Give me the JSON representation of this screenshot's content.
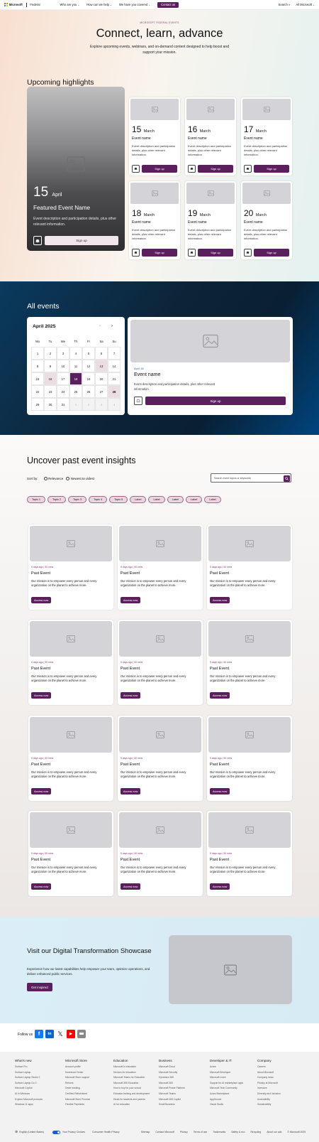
{
  "nav": {
    "brand": "Microsoft",
    "site": "Federal",
    "links": [
      "Who are you",
      "How can we help",
      "We have you covered"
    ],
    "contact": "Contact us",
    "search": "Search",
    "all": "All Microsoft",
    "logo_colors": [
      "#f25022",
      "#7fba00",
      "#00a4ef",
      "#ffb900"
    ]
  },
  "hero": {
    "eyebrow": "MICROSOFT FEDERAL EVENTS",
    "title": "Connect, learn, advance",
    "subtitle": "Explore upcoming events, webinars, and on-demand content designed to help boost and support your mission."
  },
  "highlights": {
    "title": "Upcoming highlights",
    "featured": {
      "day": "15",
      "month": "April",
      "name": "Featured Event Name",
      "desc": "Event description and participation details, plus other relevant information.",
      "signup": "Sign up"
    },
    "events": [
      {
        "day": "15",
        "month": "March",
        "name": "Event name",
        "desc": "Event description and participation details, plus other relevant information.",
        "signup": "Sign up"
      },
      {
        "day": "16",
        "month": "March",
        "name": "Event name",
        "desc": "Event description and participation details, plus other relevant information.",
        "signup": "Sign up"
      },
      {
        "day": "17",
        "month": "March",
        "name": "Event name",
        "desc": "Event description and participation details, plus other relevant information.",
        "signup": "Sign up"
      },
      {
        "day": "18",
        "month": "March",
        "name": "Event name",
        "desc": "Event description and participation details, plus other relevant information.",
        "signup": "Sign up"
      },
      {
        "day": "19",
        "month": "March",
        "name": "Event name",
        "desc": "Event description and participation details, plus other relevant information.",
        "signup": "Sign up"
      },
      {
        "day": "20",
        "month": "March",
        "name": "Event name",
        "desc": "Event description and participation details, plus other relevant information.",
        "signup": "Sign up"
      }
    ]
  },
  "all_events": {
    "title": "All events",
    "calendar": {
      "month": "April 2025",
      "prev": "‹",
      "next": "›",
      "dows": [
        "Mo",
        "Tu",
        "We",
        "Th",
        "Fr",
        "Sa",
        "Su"
      ],
      "days": [
        "1",
        "2",
        "3",
        "4",
        "5",
        "6",
        "7",
        "8",
        "9",
        "10",
        "11",
        "12",
        "13",
        "14",
        "15",
        "16",
        "17",
        "18",
        "19",
        "20",
        "21",
        "22",
        "23",
        "24",
        "25",
        "26",
        "27",
        "28",
        "29",
        "30",
        "31",
        "1",
        "2",
        "3",
        "4"
      ]
    },
    "event": {
      "date": "April 18",
      "name": "Event name",
      "desc": "Event description and participation details, plus other relevant information.",
      "signup": "Sign up"
    }
  },
  "past": {
    "title": "Uncover past event insights",
    "sort_label": "Sort by:",
    "sort_options": [
      "Relevance",
      "Newest to oldest"
    ],
    "search_placeholder": "Search event topics or keywords",
    "chips": [
      "Topic 1",
      "Topic 2",
      "Topic 3",
      "Topic 4",
      "Topic 5",
      "Label",
      "Label",
      "Label",
      "Label",
      "Label"
    ],
    "card": {
      "meta": "5 days ago | 50 mins",
      "title": "Past Event",
      "desc": "Our mission is to empower every person and every organization on the planet to achieve more.",
      "button": "Access now"
    }
  },
  "promo": {
    "title": "Visit our Digital Transformation Showcase",
    "desc": "Experience how our latest capabilities help empower your team, optimize operations, and deliver enhanced public services.",
    "button": "Get inspired"
  },
  "follow": {
    "label": "Follow us"
  },
  "footer": {
    "columns": [
      {
        "title": "What's new",
        "items": [
          "Surface Pro",
          "Surface Laptop",
          "Surface Laptop Studio 2",
          "Surface Laptop Go 3",
          "Microsoft Copilot",
          "AI in Windows",
          "Explore Microsoft products",
          "Windows 11 apps"
        ]
      },
      {
        "title": "Microsoft Store",
        "items": [
          "Account profile",
          "Download Center",
          "Microsoft Store support",
          "Returns",
          "Order tracking",
          "Certified Refurbished",
          "Microsoft Store Promise",
          "Flexible Payments"
        ]
      },
      {
        "title": "Education",
        "items": [
          "Microsoft in education",
          "Devices for education",
          "Microsoft Teams for Education",
          "Microsoft 365 Education",
          "How to buy for your school",
          "Educator training and development",
          "Deals for students and parents",
          "AI for education"
        ]
      },
      {
        "title": "Business",
        "items": [
          "Microsoft Cloud",
          "Microsoft Security",
          "Dynamics 365",
          "Microsoft 365",
          "Microsoft Power Platform",
          "Microsoft Teams",
          "Microsoft 365 Copilot",
          "Small Business"
        ]
      },
      {
        "title": "Developer & IT",
        "items": [
          "Azure",
          "Microsoft Developer",
          "Microsoft Learn",
          "Support for AI marketplace apps",
          "Microsoft Tech Community",
          "Azure Marketplace",
          "AppSource",
          "Visual Studio"
        ]
      },
      {
        "title": "Company",
        "items": [
          "Careers",
          "About Microsoft",
          "Company news",
          "Privacy at Microsoft",
          "Investors",
          "Diversity and inclusion",
          "Accessibility",
          "Sustainability"
        ]
      }
    ],
    "locale": "English (United States)",
    "privacy": "Your Privacy Choices",
    "health": "Consumer Health Privacy",
    "links": [
      "Sitemap",
      "Contact Microsoft",
      "Privacy",
      "Terms of use",
      "Trademarks",
      "Safety & eco",
      "Recycling",
      "About our ads",
      "© Microsoft 2025"
    ]
  },
  "colors": {
    "accent": "#5c1f5e",
    "highlight": "#ecdde2"
  }
}
